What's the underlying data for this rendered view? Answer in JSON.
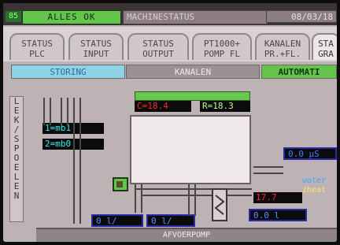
{
  "header": {
    "code": "85",
    "status_text": "ALLES OK",
    "title": "MACHINESTATUS",
    "date": "08/03/18"
  },
  "tabs": [
    {
      "label": "STATUS\nPLC"
    },
    {
      "label": "STATUS\nINPUT"
    },
    {
      "label": "STATUS\nOUTPUT"
    },
    {
      "label": "PT1000+\nPOMP FL"
    },
    {
      "label": "KANALEN\nPR.+FL."
    },
    {
      "label": "STA\nGRA"
    }
  ],
  "subtabs": {
    "storing": "STORING",
    "kanalen": "KANALEN",
    "automatic": "AUTOMATI"
  },
  "left_rail": {
    "vertical_text": "LEK/SPOELEN"
  },
  "labels": {
    "mb1": "1=mb1",
    "mb0": "2=mb0",
    "c_value": "C=18.4",
    "r_value": "R=18.3",
    "temp_value": "17.7",
    "flow_value_1": "0  l/",
    "flow_value_2": "0  l/",
    "flow_value_3": "0.0  l",
    "right_value": "0.0  µS",
    "water": "water",
    "heat": "zheat"
  },
  "bottom": {
    "label": "AFVOERPOMP"
  },
  "colors": {
    "green": "#63c54a",
    "cyan": "#30f1f1",
    "blue": "#2a2aa8",
    "red": "#ff2b2b"
  }
}
